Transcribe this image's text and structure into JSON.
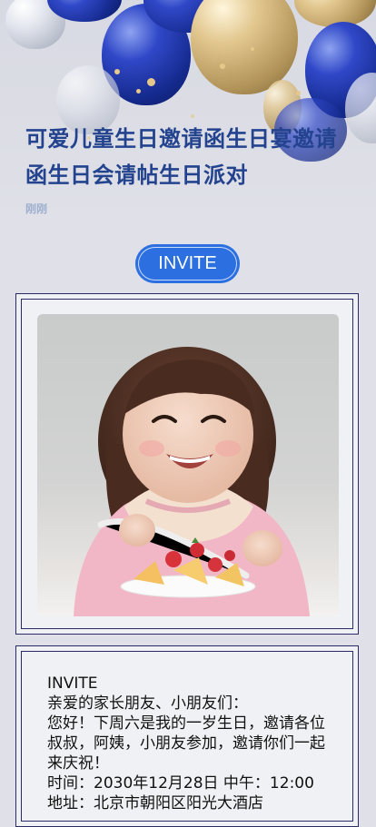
{
  "article": {
    "title": "可爱儿童生日邀请函生日宴邀请函生日会请帖生日派对",
    "time": "刚刚"
  },
  "invite_button": {
    "label": "INVITE"
  },
  "photo": {
    "alt": "smiling little girl eating fruit"
  },
  "invitation": {
    "heading": "INVITE",
    "greeting": "亲爱的家长朋友、小朋友们：",
    "body": "您好！下周六是我的一岁生日，邀请各位叔叔，阿姨，小朋友参加，邀请你们一起来庆祝！",
    "time_line": "时间：2030年12月28日  中午：12:00",
    "address_line": "地址：北京市朝阳区阳光大酒店"
  }
}
